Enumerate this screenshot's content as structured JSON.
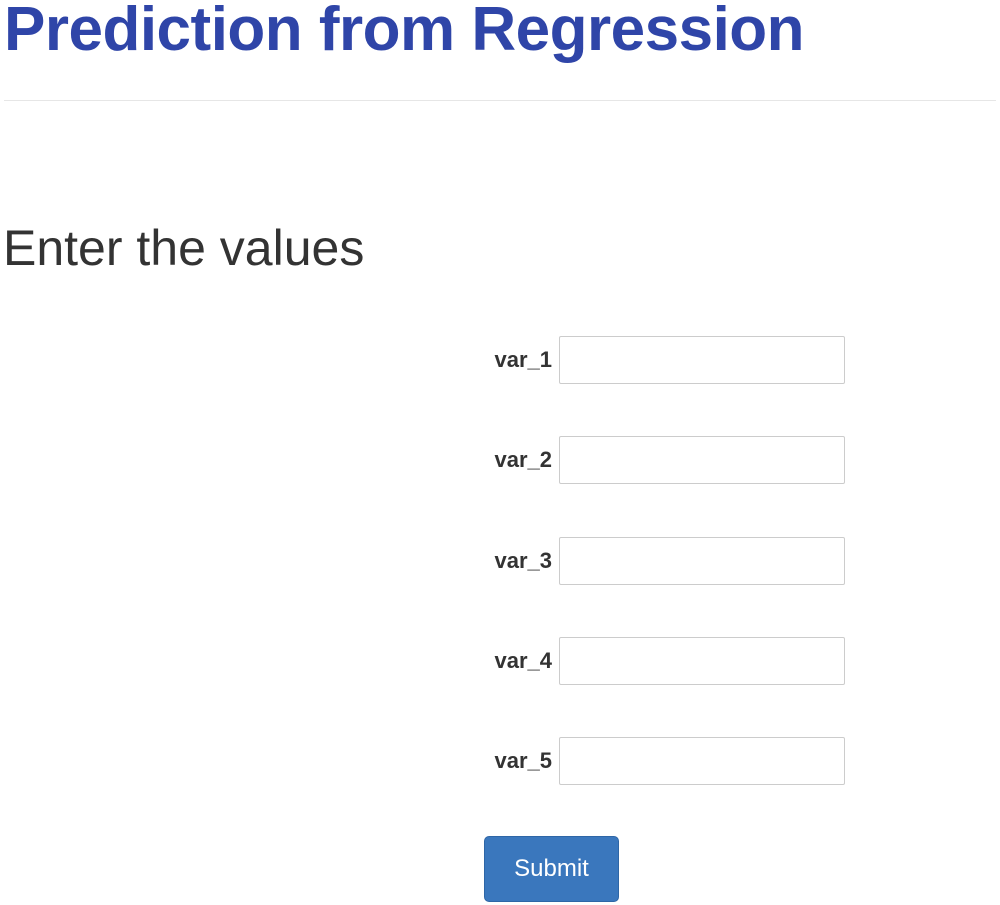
{
  "header": {
    "title": "Prediction from Regression"
  },
  "form": {
    "heading": "Enter the values",
    "fields": [
      {
        "label": "var_1",
        "value": ""
      },
      {
        "label": "var_2",
        "value": ""
      },
      {
        "label": "var_3",
        "value": ""
      },
      {
        "label": "var_4",
        "value": ""
      },
      {
        "label": "var_5",
        "value": ""
      }
    ],
    "submit_label": "Submit"
  },
  "colors": {
    "title": "#2f45a8",
    "text": "#333333",
    "button": "#3a77bd",
    "input_border": "#cccccc"
  }
}
